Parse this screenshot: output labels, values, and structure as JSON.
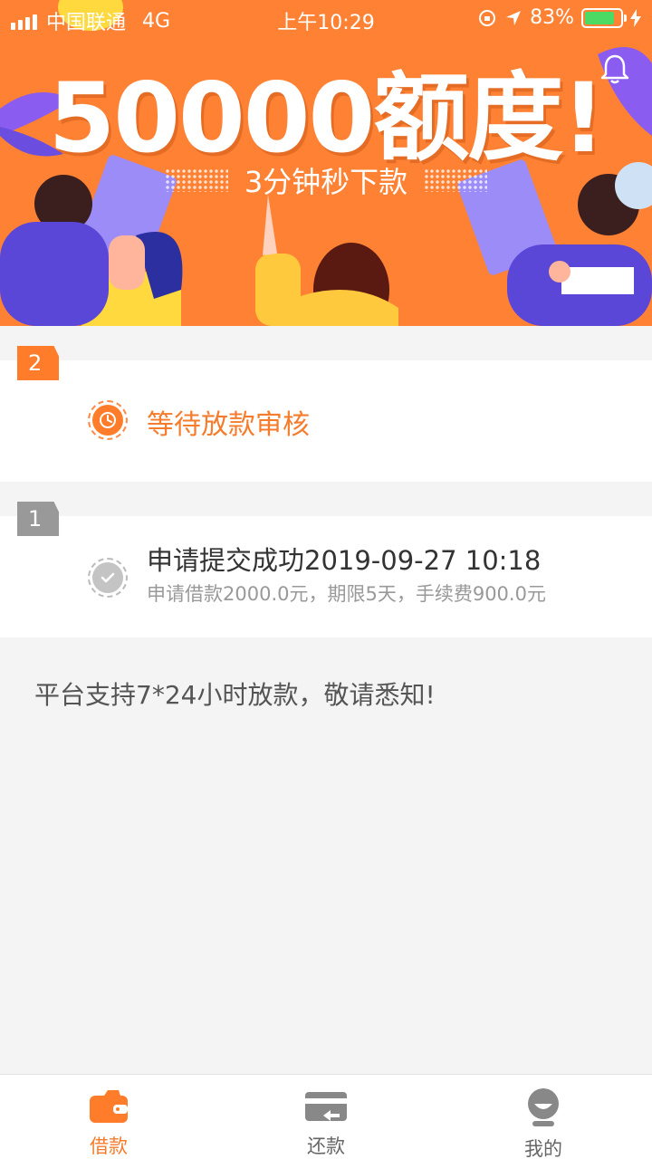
{
  "status_bar": {
    "carrier": "中国联通",
    "network": "4G",
    "time": "上午10:29",
    "battery_percent": "83%"
  },
  "banner": {
    "title": "50000额度!",
    "subtitle": "3分钟秒下款"
  },
  "steps": [
    {
      "number": "2",
      "title": "等待放款审核",
      "status": "pending"
    },
    {
      "number": "1",
      "title": "申请提交成功2019-09-27 10:18",
      "detail": "申请借款2000.0元，期限5天，手续费900.0元",
      "status": "done"
    }
  ],
  "notice": "平台支持7*24小时放款，敬请悉知!",
  "tabbar": {
    "items": [
      {
        "label": "借款",
        "icon": "wallet-icon",
        "active": true
      },
      {
        "label": "还款",
        "icon": "repay-card-icon",
        "active": false
      },
      {
        "label": "我的",
        "icon": "profile-icon",
        "active": false
      }
    ]
  },
  "colors": {
    "accent": "#ff7d2a",
    "banner_bg": "#ff8234",
    "battery_fill": "#4cd964",
    "muted": "#999999"
  }
}
